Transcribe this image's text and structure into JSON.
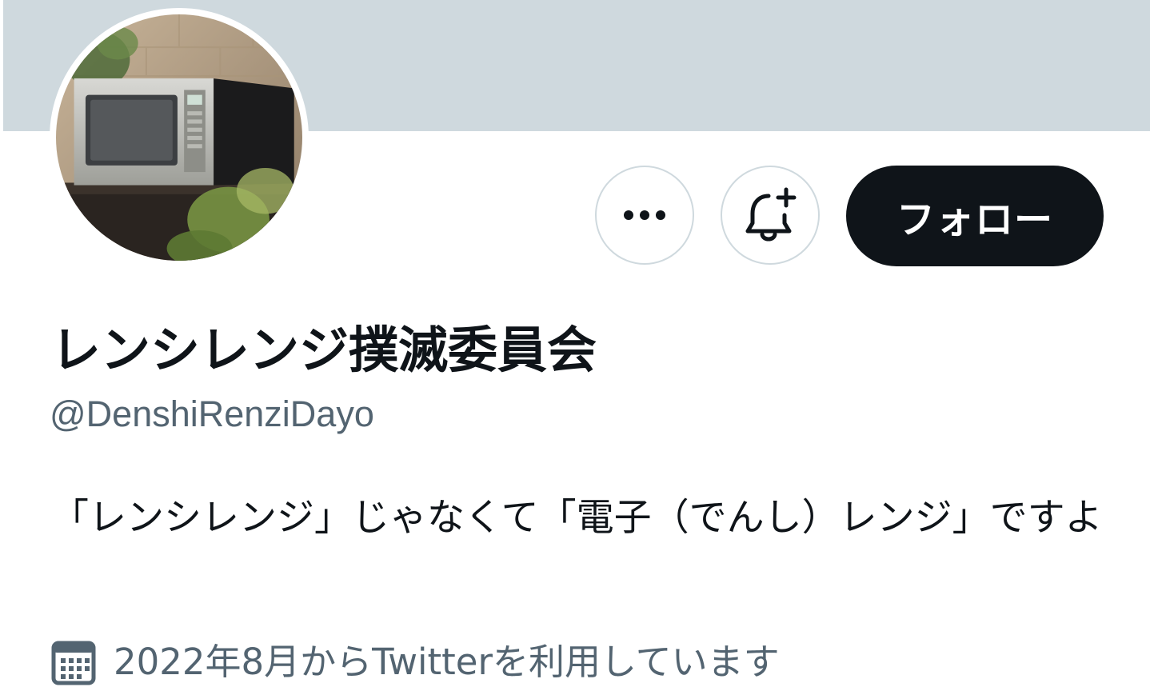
{
  "profile": {
    "display_name": "レンシレンジ撲滅委員会",
    "handle": "@DenshiRenziDayo",
    "bio": "「レンシレンジ」じゃなくて「電子（でんし）レンジ」ですよ",
    "joined": "2022年8月からTwitterを利用しています"
  },
  "actions": {
    "follow_label": "フォロー",
    "more_icon": "more-horizontal-icon",
    "notify_icon": "bell-plus-icon"
  },
  "icons": {
    "calendar": "calendar-icon"
  },
  "colors": {
    "banner": "#cfd9de",
    "primary_text": "#0f1419",
    "secondary_text": "#536471",
    "follow_button": "#0f1419",
    "button_border": "#cfd9de"
  }
}
